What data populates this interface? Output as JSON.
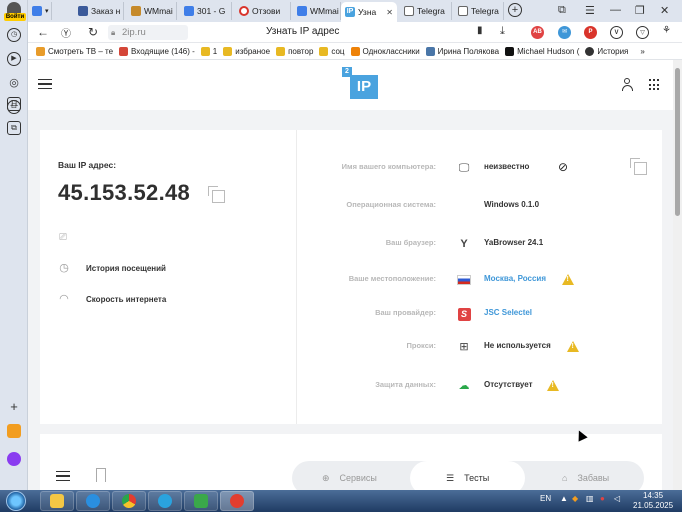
{
  "rail": {
    "profile_label": "Войти"
  },
  "tabs": [
    {
      "label": "",
      "icon": "tab-thumb-icon"
    },
    {
      "label": "Заказ н",
      "icon": "monitor-icon",
      "color": "#3b5a9a"
    },
    {
      "label": "WMmai",
      "icon": "wm-icon",
      "color": "#c68a2a"
    },
    {
      "label": "301 - G",
      "icon": "docs-icon",
      "color": "#3f7ee8"
    },
    {
      "label": "Отзови",
      "icon": "circle-icon",
      "color": "#d9342b"
    },
    {
      "label": "WMmai",
      "icon": "wm-icon",
      "color": "#3f7ee8"
    },
    {
      "label": "Узна",
      "icon": "ip-icon",
      "color": "#4aa3df",
      "active": true
    },
    {
      "label": "Telegra",
      "icon": "doc-icon",
      "color": "#666"
    },
    {
      "label": "Telegra",
      "icon": "doc-icon",
      "color": "#666"
    }
  ],
  "address": {
    "url": "2ip.ru",
    "page_title": "Узнать IP адрес"
  },
  "bookmarks": [
    {
      "label": "Смотреть ТВ – те",
      "color": "#e89c2a"
    },
    {
      "label": "Входящие (146) -",
      "color": "#d44638"
    },
    {
      "label": "1",
      "color": "#e8b923"
    },
    {
      "label": "избраное",
      "color": "#e8b923"
    },
    {
      "label": "повтор",
      "color": "#e8b923"
    },
    {
      "label": "соц",
      "color": "#e8b923"
    },
    {
      "label": "Одноклассники",
      "color": "#ee8208"
    },
    {
      "label": "Ирина Полякова",
      "color": "#4a76a8"
    },
    {
      "label": "Michael Hudson (",
      "color": "#111"
    },
    {
      "label": "История",
      "color": "#333"
    }
  ],
  "logo": {
    "main": "IP",
    "tiny": "2"
  },
  "ip": {
    "label": "Ваш IP адрес:",
    "value": "45.153.52.48"
  },
  "left_links": [
    {
      "label": "История посещений",
      "icon": "history-icon"
    },
    {
      "label": "Скорость интернета",
      "icon": "speedometer-icon"
    }
  ],
  "info_rows": [
    {
      "label": "Имя вашего компьютера:",
      "value": "неизвестно",
      "icon": "monitor-icon",
      "warn": false
    },
    {
      "label": "Операционная система:",
      "value": "Windows 0.1.0",
      "icon": "",
      "warn": false
    },
    {
      "label": "Ваш браузер:",
      "value": "YaBrowser 24.1",
      "icon": "yandex-icon",
      "warn": false
    },
    {
      "label": "Ваше местоположение:",
      "value": "Москва, Россия",
      "icon": "russia-flag-icon",
      "warn": true,
      "link": true
    },
    {
      "label": "Ваш провайдер:",
      "value": "JSC Selectel",
      "icon": "selectel-icon",
      "warn": false,
      "link": true
    },
    {
      "label": "Прокси:",
      "value": "Не используется",
      "icon": "network-icon",
      "warn": true
    },
    {
      "label": "Защита данных:",
      "value": "Отсутствует",
      "icon": "cloud-lock-icon",
      "warn": true
    }
  ],
  "bottom_tabs": [
    {
      "label": "Сервисы",
      "icon": "globe-icon"
    },
    {
      "label": "Тесты",
      "icon": "list-icon",
      "active": true
    },
    {
      "label": "Забавы",
      "icon": "cake-icon"
    }
  ],
  "taskbar": {
    "lang": "EN",
    "time": "14:35",
    "date": "21.05.2025"
  },
  "colors": {
    "accent": "#4aa3df",
    "warning": "#e8b923",
    "link": "#3f97d8"
  }
}
